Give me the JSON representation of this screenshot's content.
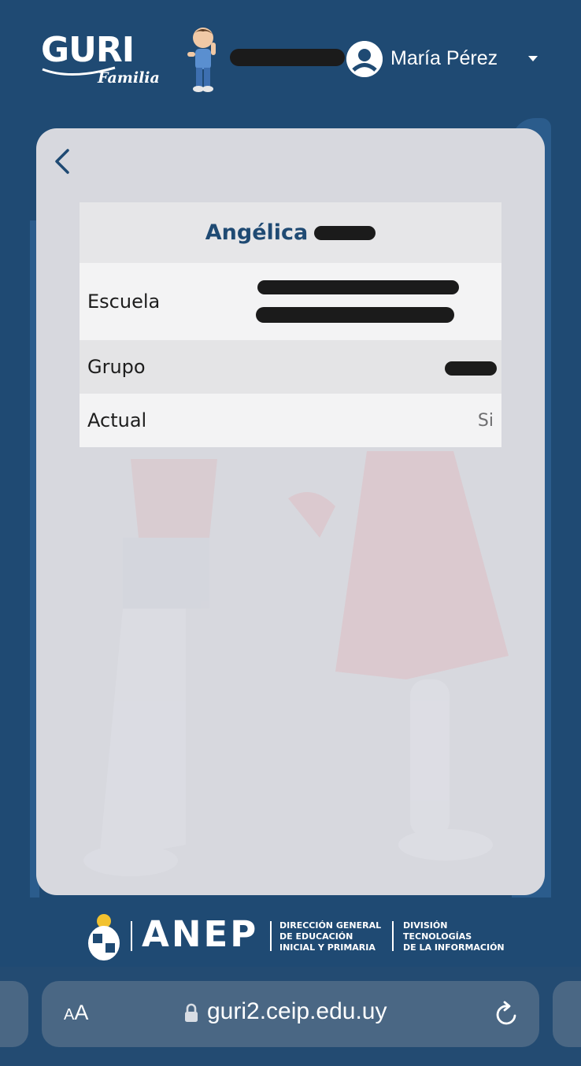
{
  "header": {
    "logo_main": "GURI",
    "logo_sub": "Familia",
    "user_name": "María Pérez",
    "icons": [
      "child-avatar-icon",
      "user-circle-icon",
      "caret-down-icon"
    ]
  },
  "card": {
    "student_name": "Angélica",
    "rows": [
      {
        "label": "Escuela",
        "value": ""
      },
      {
        "label": "Grupo",
        "value": ""
      },
      {
        "label": "Actual",
        "value": "Si"
      }
    ],
    "icons": [
      "back-chevron-icon"
    ]
  },
  "footer": {
    "brand": "ANEP",
    "direccion_lines": [
      "DIRECCIÓN GENERAL",
      "DE EDUCACIÓN",
      "INICIAL Y PRIMARIA"
    ],
    "division_lines": [
      "DIVISIÓN",
      "TECNOLOGÍAS",
      "DE LA INFORMACIÓN"
    ]
  },
  "browser": {
    "text_size_small": "A",
    "text_size_big": "A",
    "url": "guri2.ceip.edu.uy",
    "icons": [
      "lock-icon",
      "reload-icon"
    ]
  },
  "colors": {
    "background": "#1f4a73",
    "card": "#d7d8de",
    "title_text": "#1f4a73",
    "browser_pill": "#4a6784"
  }
}
